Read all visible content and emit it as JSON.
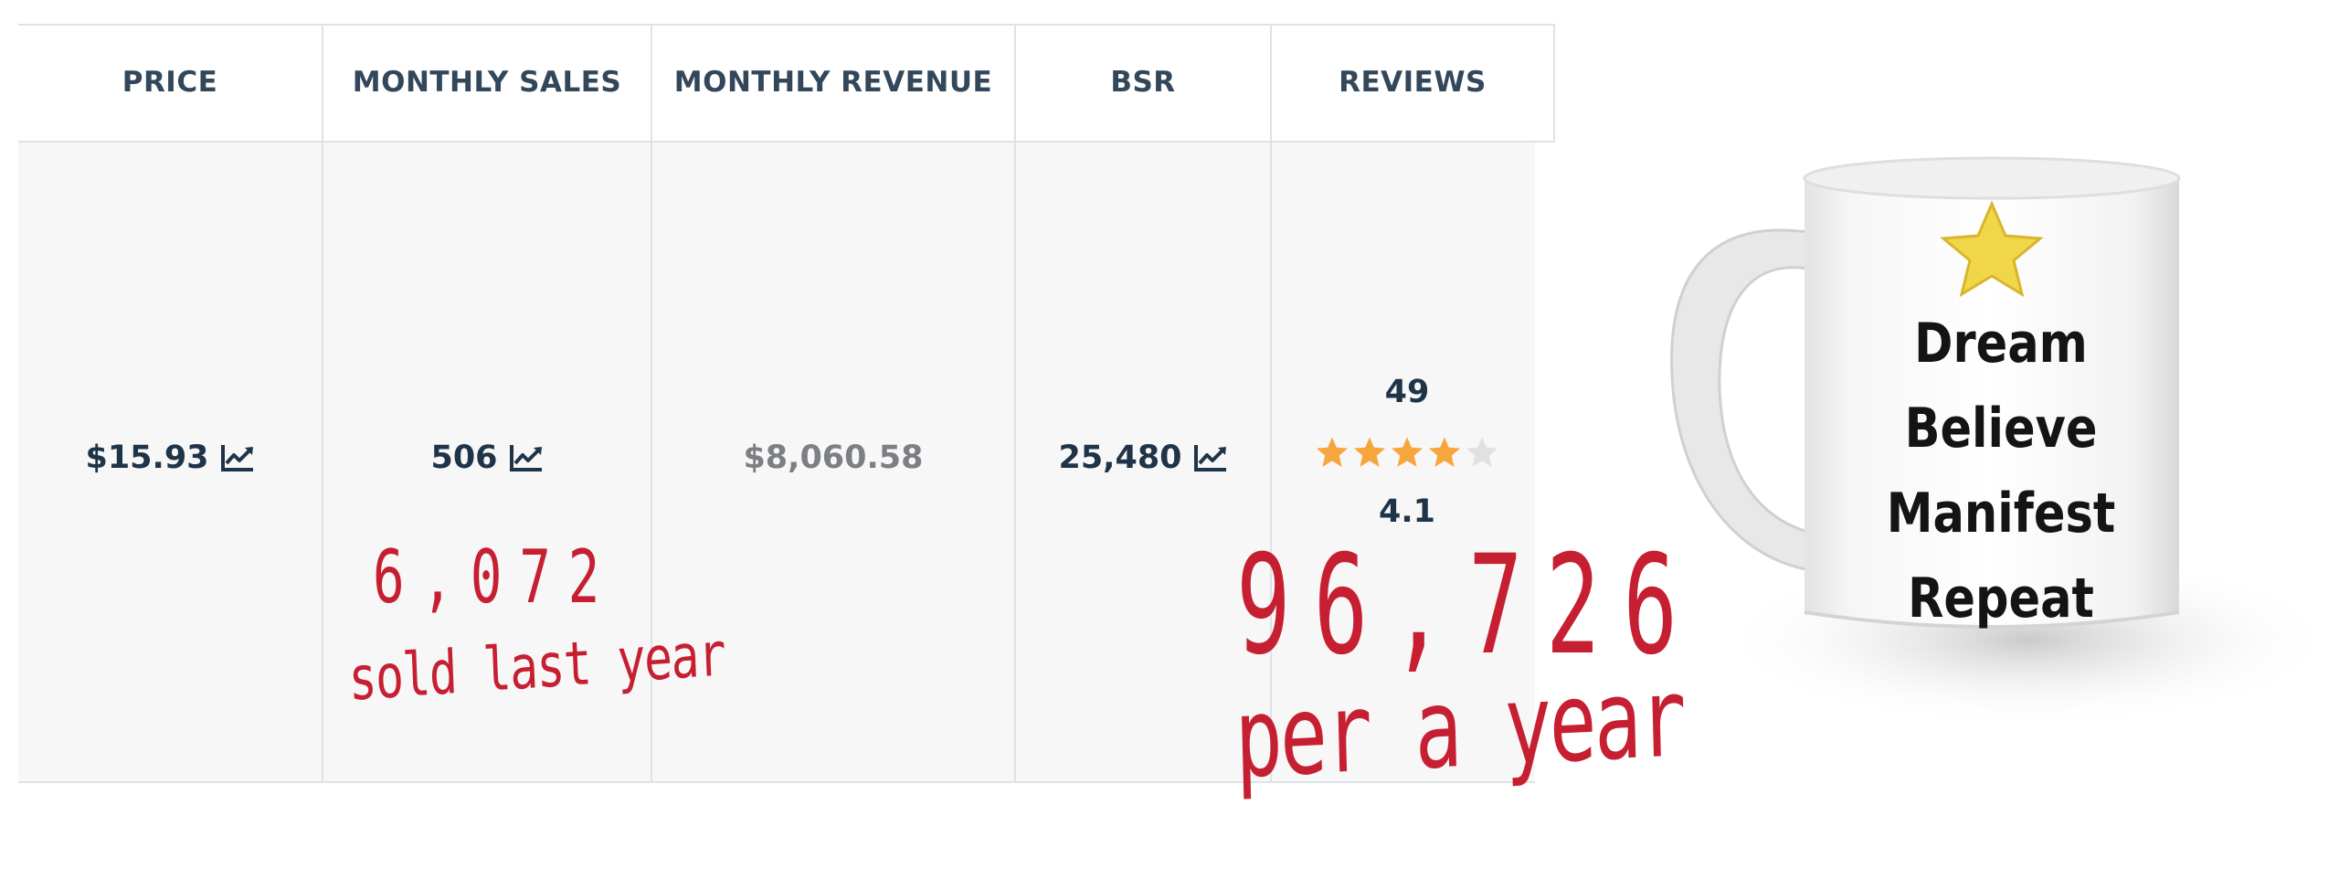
{
  "table": {
    "headers": [
      "PRICE",
      "MONTHLY SALES",
      "MONTHLY REVENUE",
      "BSR",
      "REVIEWS"
    ],
    "row": {
      "price": "$15.93",
      "monthly_sales": "506",
      "monthly_revenue": "$8,060.58",
      "bsr": "25,480",
      "reviews_count": "49",
      "rating": 4.1,
      "rating_text": "4.1",
      "stars_filled": 4,
      "stars_total": 5
    },
    "trend_icon": "trend-chart-icon"
  },
  "annotations": {
    "sales_number": "6,072",
    "sales_caption": "sold last year",
    "revenue_number": "96,726",
    "revenue_caption": "per a year"
  },
  "mug": {
    "lines": [
      "Dream",
      "Believe",
      "Manifest",
      "Repeat"
    ],
    "icon": "star-icon"
  },
  "colors": {
    "header_text": "#33475b",
    "value_text": "#1f3448",
    "muted_value": "#7c7f83",
    "star_filled": "#f6a63d",
    "star_empty": "#e1e1e1",
    "annotation": "#c61f32",
    "mug_star": "#f2d64a"
  }
}
